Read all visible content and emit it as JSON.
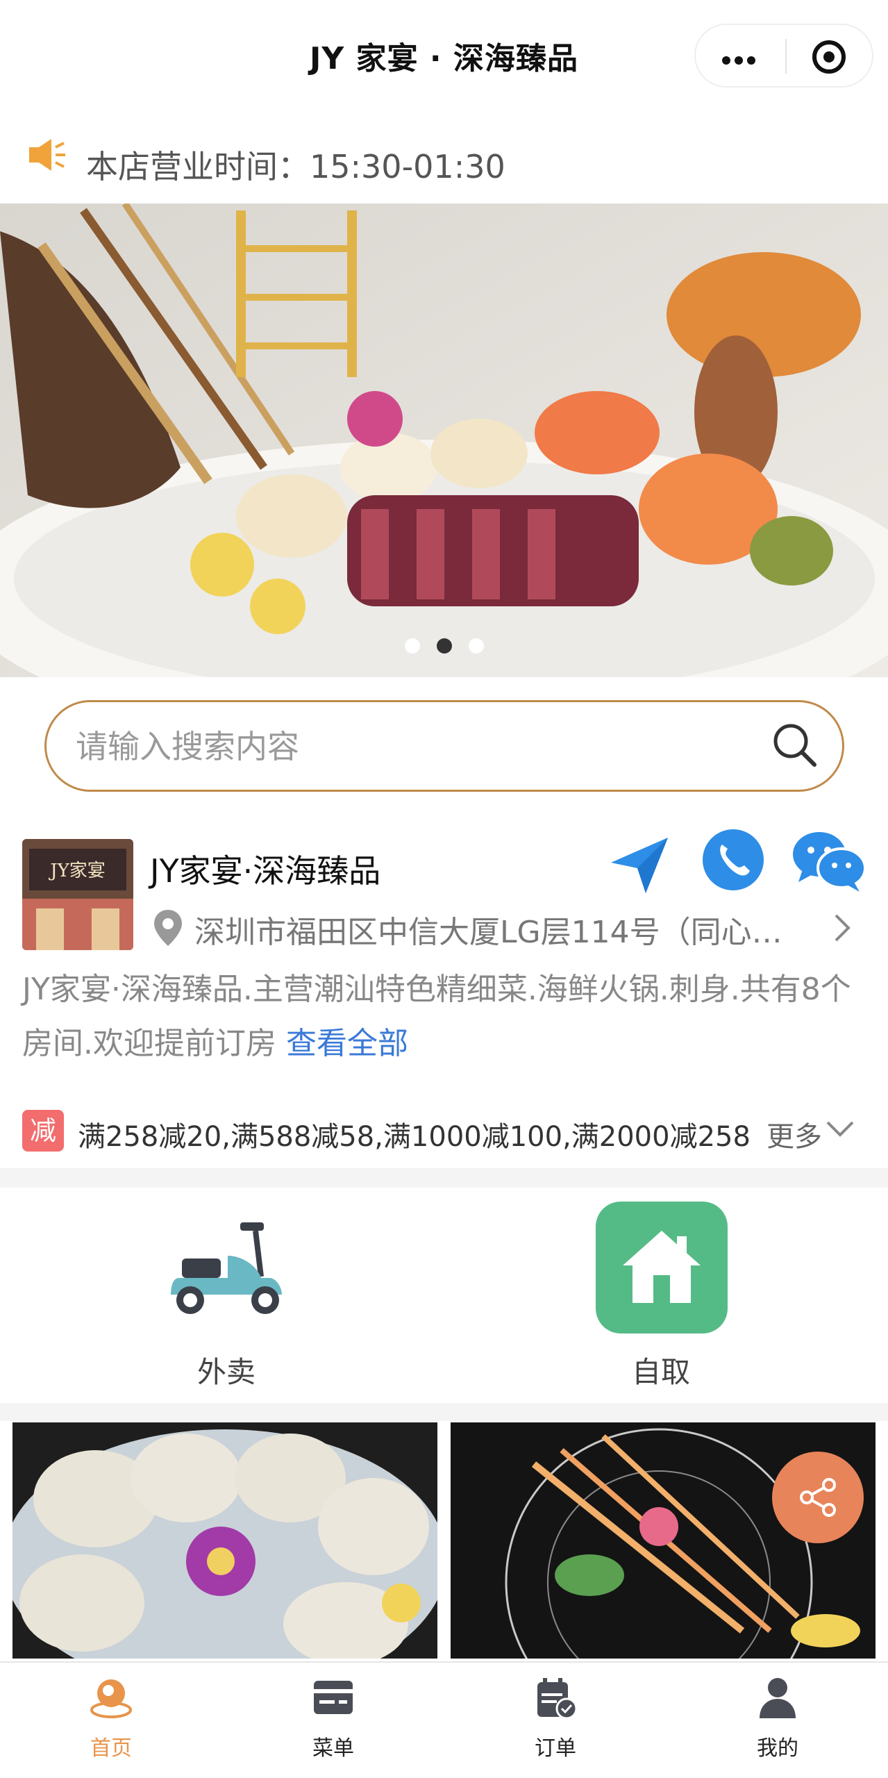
{
  "header": {
    "title": "JY 家宴 · 深海臻品"
  },
  "notice": {
    "text": "本店营业时间：15:30-01:30"
  },
  "banner": {
    "dot_count": 3,
    "active_dot": 1
  },
  "search": {
    "placeholder": "请输入搜索内容"
  },
  "shop": {
    "name": "JY家宴·深海臻品",
    "thumb_sign": "JY家宴",
    "address": "深圳市福田区中信大厦LG层114号（同心…",
    "description": "JY家宴·深海臻品.主营潮汕特色精细菜.海鲜火锅.刺身.共有8个房间.欢迎提前订房",
    "view_all": "查看全部"
  },
  "promotion": {
    "badge": "减",
    "text": "满258减20,满588减58,满1000减100,满2000减258",
    "more": "更多"
  },
  "order_modes": {
    "delivery": "外卖",
    "pickup": "自取"
  },
  "tabbar": {
    "items": [
      {
        "label": "首页"
      },
      {
        "label": "菜单"
      },
      {
        "label": "订单"
      },
      {
        "label": "我的"
      }
    ],
    "active_index": 0
  },
  "colors": {
    "accent": "#e8944a",
    "search_border": "#c08a4a",
    "link": "#3a7ad8",
    "promo_badge": "#f26d6d",
    "pickup_tile": "#55bb86",
    "action_blue": "#2e8de6",
    "share": "#e8845a"
  },
  "icons": [
    "menu-dots-icon",
    "target-icon",
    "speaker-icon",
    "search-icon",
    "navigate-icon",
    "phone-icon",
    "wechat-icon",
    "location-pin-icon",
    "chevron-right-icon",
    "chevron-down-icon",
    "scooter-icon",
    "house-icon",
    "share-icon",
    "home-tab-icon",
    "menu-tab-icon",
    "order-tab-icon",
    "profile-tab-icon"
  ]
}
